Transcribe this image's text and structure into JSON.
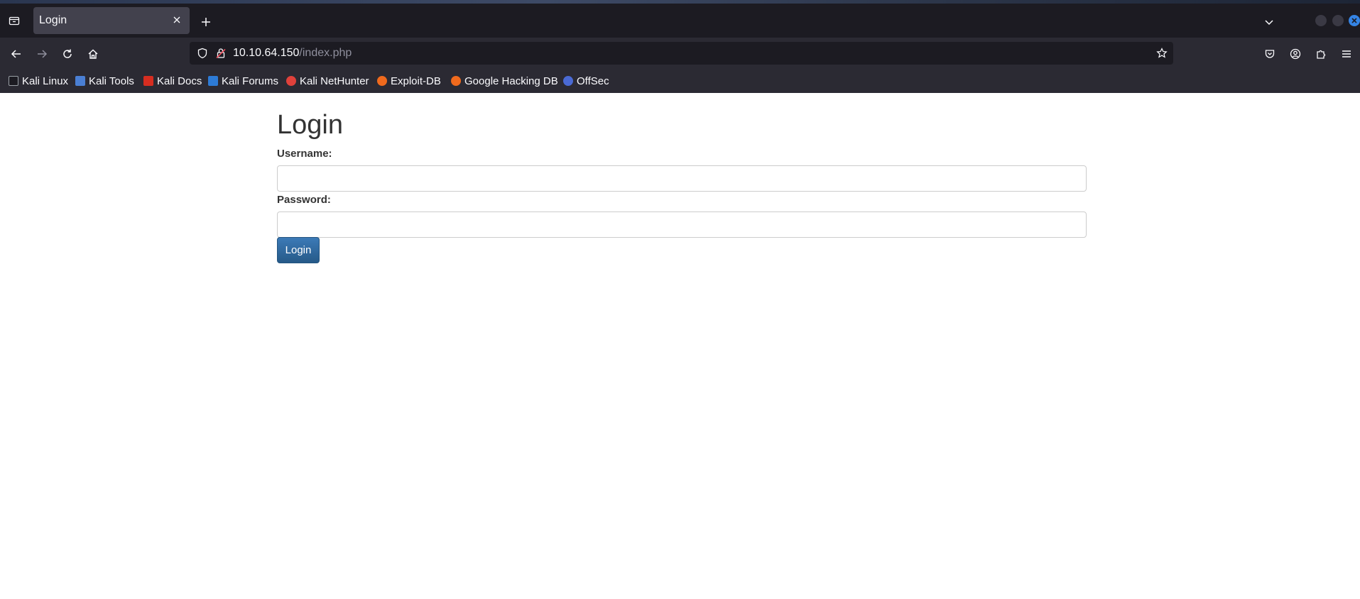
{
  "browser": {
    "tab": {
      "title": "Login"
    },
    "url": {
      "host": "10.10.64.150",
      "path": "/index.php"
    },
    "bookmarks": [
      {
        "label": "Kali Linux",
        "icon": "kali-dragon-icon",
        "color": "#1c1b22"
      },
      {
        "label": "Kali Tools",
        "icon": "kali-tools-icon",
        "color": "#4a7fd4"
      },
      {
        "label": "Kali Docs",
        "icon": "kali-docs-icon",
        "color": "#d62d20"
      },
      {
        "label": "Kali Forums",
        "icon": "kali-forums-icon",
        "color": "#2d7bd6"
      },
      {
        "label": "Kali NetHunter",
        "icon": "nethunter-icon",
        "color": "#e0413b"
      },
      {
        "label": "Exploit-DB",
        "icon": "exploit-db-icon",
        "color": "#f06a1d"
      },
      {
        "label": "Google Hacking DB",
        "icon": "ghdb-icon",
        "color": "#f06a1d"
      },
      {
        "label": "OffSec",
        "icon": "offsec-icon",
        "color": "#4a6ad4"
      }
    ]
  },
  "page": {
    "title": "Login",
    "username_label": "Username:",
    "password_label": "Password:",
    "username_value": "",
    "password_value": "",
    "submit_label": "Login"
  },
  "colors": {
    "button": "#337ab7",
    "text": "#333333",
    "input_border": "#cccccc"
  }
}
